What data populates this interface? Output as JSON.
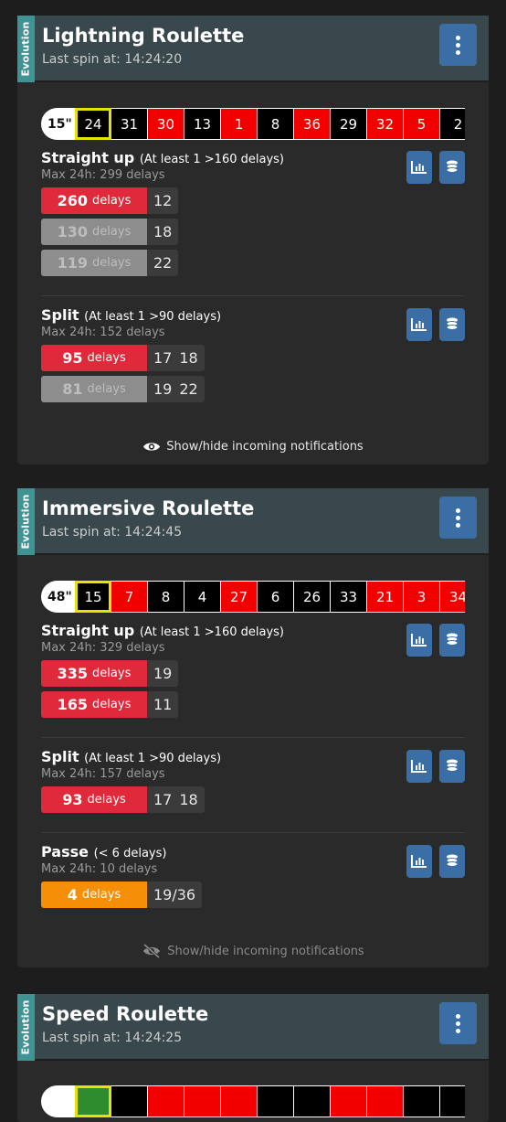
{
  "colors": {
    "red": "#e0293a",
    "wheel_red": "#f20000",
    "accent_blue": "#3a6ea5",
    "provider_teal": "#3f9393",
    "orange": "#f58f07"
  },
  "cards": [
    {
      "provider": "Evolution",
      "title": "Lightning Roulette",
      "last_spin": "Last spin at: 14:24:20",
      "timer": "15\"",
      "history": [
        {
          "n": "24",
          "c": "black"
        },
        {
          "n": "31",
          "c": "black"
        },
        {
          "n": "30",
          "c": "red"
        },
        {
          "n": "13",
          "c": "black"
        },
        {
          "n": "1",
          "c": "red"
        },
        {
          "n": "8",
          "c": "black"
        },
        {
          "n": "36",
          "c": "red"
        },
        {
          "n": "29",
          "c": "black"
        },
        {
          "n": "32",
          "c": "red"
        },
        {
          "n": "5",
          "c": "red"
        },
        {
          "n": "2",
          "c": "black"
        }
      ],
      "sections": [
        {
          "title": "Straight up",
          "condition": "(At least 1 >160 delays)",
          "max": "Max 24h: 299 delays",
          "rows": [
            {
              "value": "260",
              "unit": "delays",
              "nums": [
                "12"
              ],
              "color": "red"
            },
            {
              "value": "130",
              "unit": "delays",
              "nums": [
                "18"
              ],
              "color": "gray"
            },
            {
              "value": "119",
              "unit": "delays",
              "nums": [
                "22"
              ],
              "color": "gray"
            }
          ]
        },
        {
          "title": "Split",
          "condition": "(At least 1 >90 delays)",
          "max": "Max 24h: 152 delays",
          "rows": [
            {
              "value": "95",
              "unit": "delays",
              "nums": [
                "17",
                "18"
              ],
              "color": "red"
            },
            {
              "value": "81",
              "unit": "delays",
              "nums": [
                "19",
                "22"
              ],
              "color": "gray"
            }
          ]
        }
      ],
      "notifications": "Show/hide incoming notifications"
    },
    {
      "provider": "Evolution",
      "title": "Immersive Roulette",
      "last_spin": "Last spin at: 14:24:45",
      "timer": "48\"",
      "history": [
        {
          "n": "15",
          "c": "black"
        },
        {
          "n": "7",
          "c": "red"
        },
        {
          "n": "8",
          "c": "black"
        },
        {
          "n": "4",
          "c": "black"
        },
        {
          "n": "27",
          "c": "red"
        },
        {
          "n": "6",
          "c": "black"
        },
        {
          "n": "26",
          "c": "black"
        },
        {
          "n": "33",
          "c": "black"
        },
        {
          "n": "21",
          "c": "red"
        },
        {
          "n": "3",
          "c": "red"
        },
        {
          "n": "34",
          "c": "red"
        }
      ],
      "sections": [
        {
          "title": "Straight up",
          "condition": "(At least 1 >160 delays)",
          "max": "Max 24h: 329 delays",
          "rows": [
            {
              "value": "335",
              "unit": "delays",
              "nums": [
                "19"
              ],
              "color": "red"
            },
            {
              "value": "165",
              "unit": "delays",
              "nums": [
                "11"
              ],
              "color": "red"
            }
          ]
        },
        {
          "title": "Split",
          "condition": "(At least 1 >90 delays)",
          "max": "Max 24h: 157 delays",
          "rows": [
            {
              "value": "93",
              "unit": "delays",
              "nums": [
                "17",
                "18"
              ],
              "color": "red"
            }
          ]
        },
        {
          "title": "Passe",
          "condition": "(< 6 delays)",
          "max": "Max 24h: 10 delays",
          "rows": [
            {
              "value": "4",
              "unit": "delays",
              "nums": [
                "19/36"
              ],
              "color": "orange"
            }
          ]
        }
      ],
      "notifications": "Show/hide incoming notifications"
    },
    {
      "provider": "Evolution",
      "title": "Speed Roulette",
      "last_spin": "Last spin at: 14:24:25",
      "history": [
        {
          "n": "",
          "c": "green"
        },
        {
          "n": "",
          "c": "black"
        },
        {
          "n": "",
          "c": "red"
        },
        {
          "n": "",
          "c": "red"
        },
        {
          "n": "",
          "c": "red"
        },
        {
          "n": "",
          "c": "black"
        },
        {
          "n": "",
          "c": "black"
        },
        {
          "n": "",
          "c": "red"
        },
        {
          "n": "",
          "c": "red"
        },
        {
          "n": "",
          "c": "black"
        },
        {
          "n": "",
          "c": "black"
        }
      ]
    }
  ]
}
